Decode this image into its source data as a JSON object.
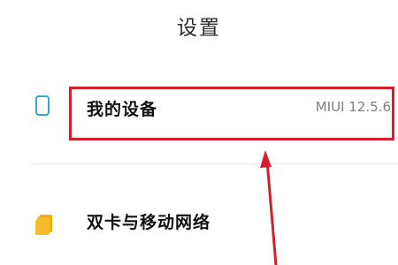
{
  "header": {
    "title": "设置"
  },
  "items": [
    {
      "label": "我的设备",
      "value": "MIUI 12.5.6",
      "icon": "phone-icon"
    },
    {
      "label": "双卡与移动网络",
      "icon": "sim-card-icon"
    }
  ],
  "annotation": {
    "color": "#d51f2c"
  },
  "colors": {
    "phone_icon": "#33a7d8",
    "sim_icon": "#f6bd28"
  }
}
